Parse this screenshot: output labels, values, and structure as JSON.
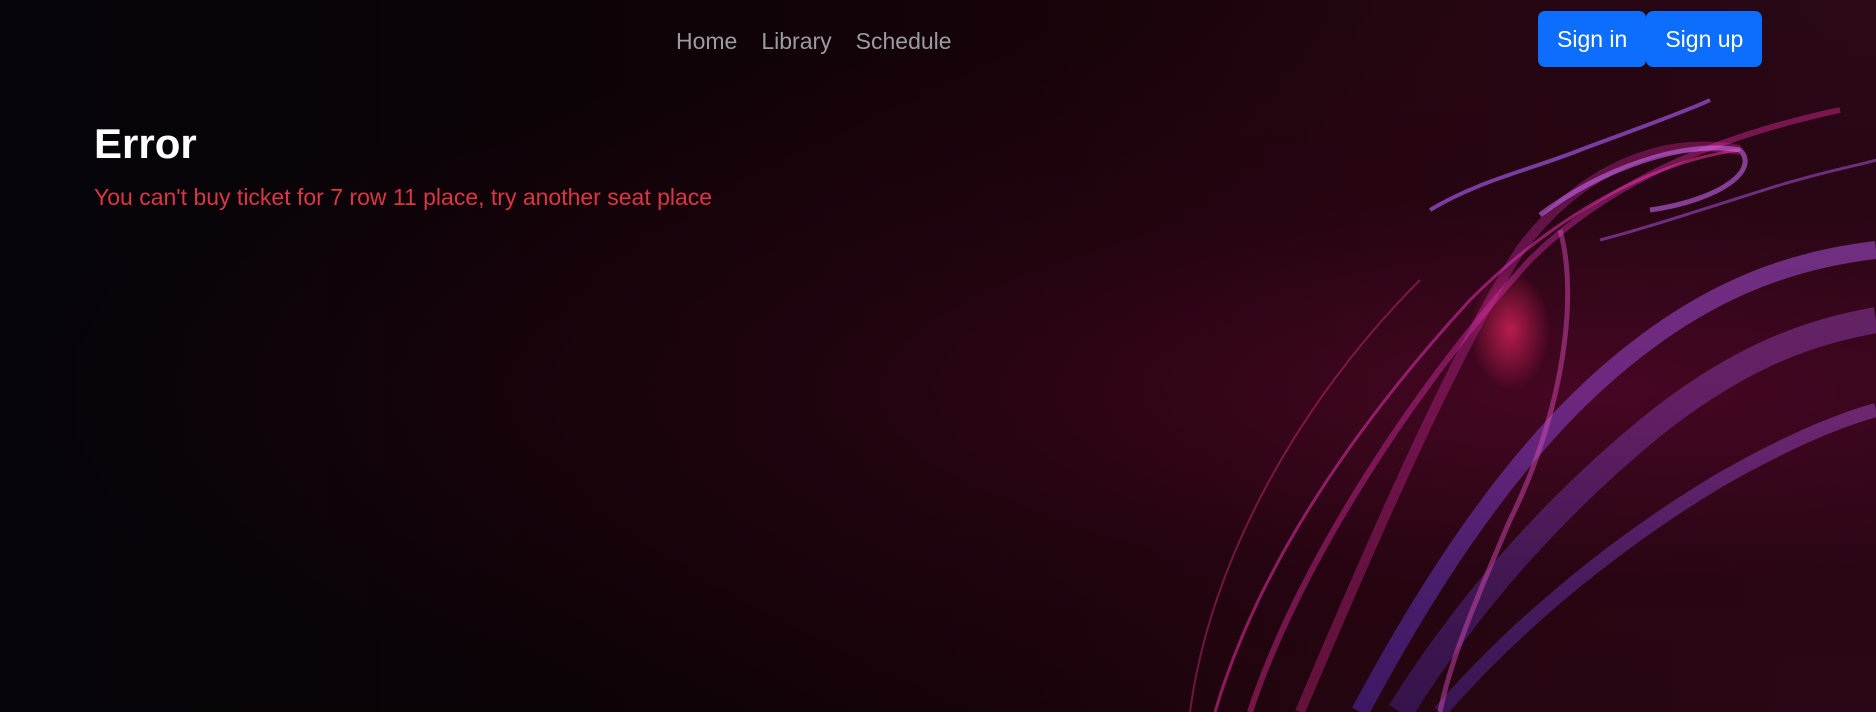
{
  "nav": {
    "links": [
      "Home",
      "Library",
      "Schedule"
    ],
    "sign_in": "Sign in",
    "sign_up": "Sign up"
  },
  "main": {
    "title": "Error",
    "message": "You can't buy ticket for 7 row 11 place, try another seat place"
  },
  "colors": {
    "button": "#0d6efd",
    "error_text": "#dc3545",
    "nav_link": "#9b9ba3",
    "title": "#ffffff"
  }
}
